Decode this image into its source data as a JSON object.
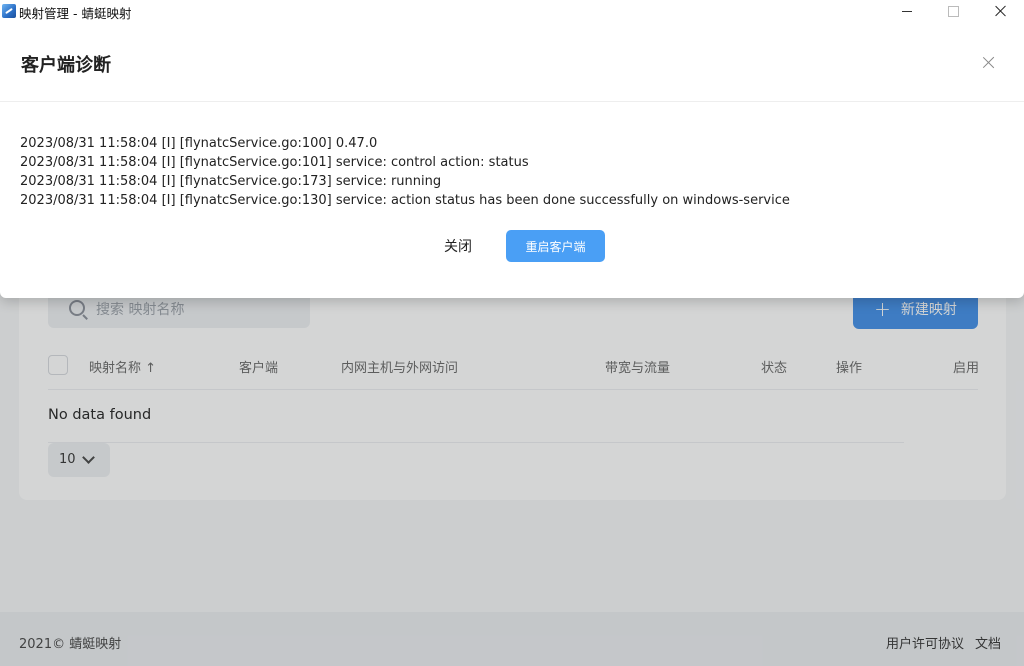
{
  "window": {
    "title": "映射管理 - 蜻蜓映射"
  },
  "dialog": {
    "title": "客户端诊断",
    "logs": [
      "2023/08/31 11:58:04 [I] [flynatcService.go:100] 0.47.0",
      "2023/08/31 11:58:04 [I] [flynatcService.go:101] service: control action: status",
      "2023/08/31 11:58:04 [I] [flynatcService.go:173] service: running",
      "2023/08/31 11:58:04 [I] [flynatcService.go:130] service: action status has been done successfully on windows-service"
    ],
    "close_label": "关闭",
    "restart_label": "重启客户端"
  },
  "toolbar": {
    "search_placeholder": "搜索 映射名称",
    "new_label": "新建映射"
  },
  "table": {
    "columns": [
      "映射名称 ↑",
      "客户端",
      "内网主机与外网访问",
      "带宽与流量",
      "状态",
      "操作",
      "启用"
    ],
    "empty_text": "No data found",
    "page_size": "10"
  },
  "footer": {
    "copyright": "2021© 蜻蜓映射",
    "links": [
      "用户许可协议",
      "文档"
    ]
  },
  "colors": {
    "primary": "#4a9ff5",
    "primary_dark": "#3f8ee8",
    "overlay": "rgba(60,62,66,0.22)"
  }
}
